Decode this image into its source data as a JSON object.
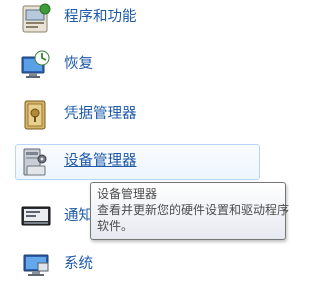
{
  "items": [
    {
      "label": "程序和功能",
      "icon": "programs-features-icon"
    },
    {
      "label": "恢复",
      "icon": "recovery-icon"
    },
    {
      "label": "凭据管理器",
      "icon": "credential-manager-icon"
    },
    {
      "label": "设备管理器",
      "icon": "device-manager-icon"
    },
    {
      "label": "通知",
      "icon": "notification-icon"
    },
    {
      "label": "系统",
      "icon": "system-icon"
    }
  ],
  "tooltip": {
    "title": "设备管理器",
    "line1": "查看并更新您的硬件设置和驱动程序",
    "line2": "软件。"
  },
  "colors": {
    "link": "#1e5aa8",
    "hover_border": "#b8d6fb",
    "tooltip_border": "#767676"
  }
}
